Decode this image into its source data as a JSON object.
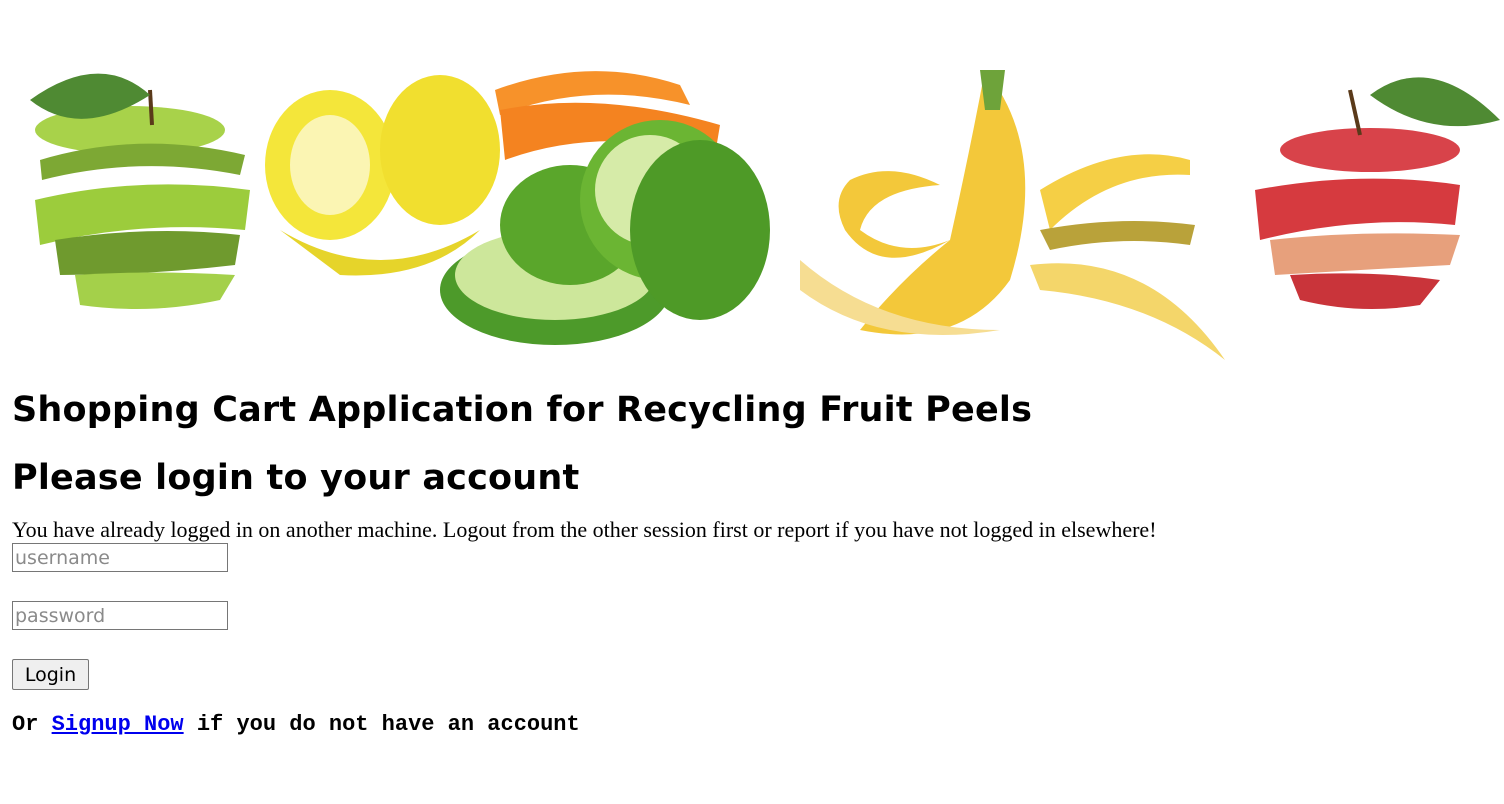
{
  "banner": {
    "fruits": [
      "green-apple-peel",
      "lemon-peel",
      "orange-lime-peel",
      "banana-peel",
      "red-apple-peel"
    ]
  },
  "page": {
    "title": "Shopping Cart Application for Recycling Fruit Peels",
    "subtitle": "Please login to your account",
    "notice": "You have already logged in on another machine. Logout from the other session first or report if you have not logged in elsewhere!"
  },
  "form": {
    "username_placeholder": "username",
    "password_placeholder": "password",
    "login_label": "Login"
  },
  "signup": {
    "prefix": "Or ",
    "link_text": "Signup Now",
    "suffix": " if you do not have an account"
  },
  "colors": {
    "link": "#0000ee",
    "green_apple": "#9ccc3c",
    "lemon": "#f4e63a",
    "orange": "#f7922a",
    "lime": "#5aa62b",
    "banana": "#f3c83a",
    "red_apple": "#d63a3f"
  }
}
